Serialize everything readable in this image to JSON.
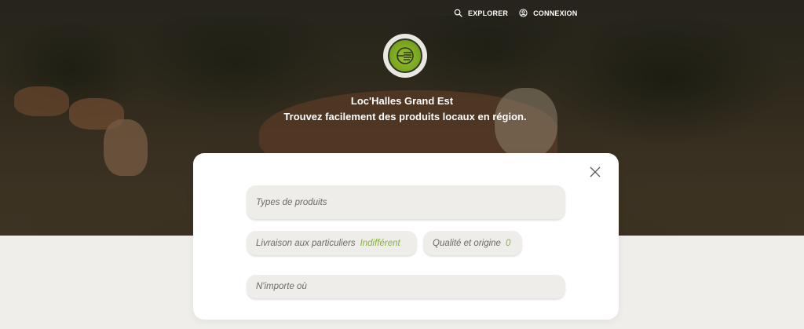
{
  "nav": {
    "explore_label": "EXPLORER",
    "login_label": "CONNEXION"
  },
  "hero": {
    "title": "Loc'Halles Grand Est",
    "subtitle": "Trouvez facilement des produits locaux en région."
  },
  "search": {
    "product_types_placeholder": "Types de produits",
    "delivery_label": "Livraison aux particuliers",
    "delivery_value": "Indifférent",
    "quality_label": "Qualité et origine",
    "quality_value": "0",
    "location_placeholder": "N'importe où"
  },
  "icons": {
    "search": "search-icon",
    "user": "user-icon",
    "close": "close-icon",
    "logo": "logo-icon"
  },
  "colors": {
    "accent": "#86b23a",
    "card_bg": "#ffffff",
    "field_bg": "#efedea",
    "page_bg": "#f0eeea"
  }
}
